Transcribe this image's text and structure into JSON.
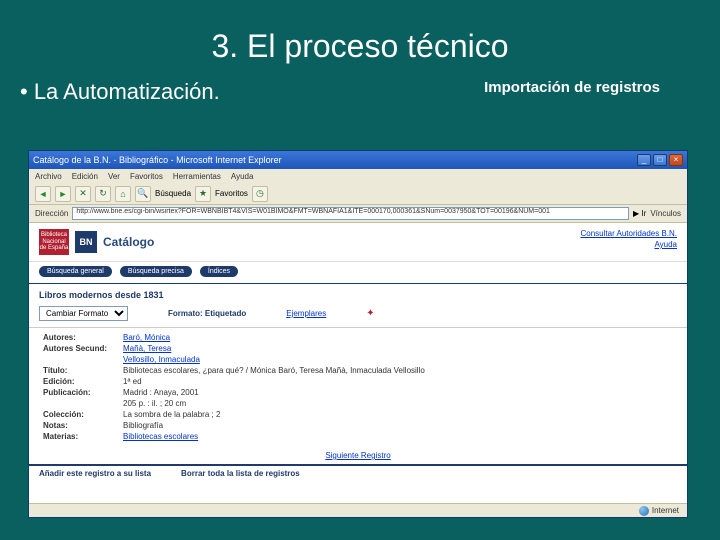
{
  "slide": {
    "title": "3. El proceso técnico",
    "bullet": "• La Automatización.",
    "subtitle": "Importación de registros"
  },
  "window": {
    "title": "Catálogo de la B.N. - Bibliográfico - Microsoft Internet Explorer",
    "menu": [
      "Archivo",
      "Edición",
      "Ver",
      "Favoritos",
      "Herramientas",
      "Ayuda"
    ],
    "toolbar": {
      "search": "Búsqueda",
      "favs": "Favoritos"
    },
    "addr": {
      "label": "Dirección",
      "url": "http://www.bne.es/cgi-bin/wsirtex?FOR=WBNBIBT4&VIS=W01BIMO&FMT=WBNAFIA1&ITE=000170,000361&SNum=0037950&TOT=00196&NUM=001",
      "go": "Ir",
      "links": "Vínculos"
    }
  },
  "page": {
    "logo": {
      "top": "Biblioteca",
      "mid": "Nacional",
      "bot": "de España",
      "bn": "BN",
      "catalogo": "Catálogo"
    },
    "links": {
      "authorities": "Consultar Autoridades B.N.",
      "help": "Ayuda"
    },
    "tabs": [
      "Búsqueda general",
      "Búsqueda precisa",
      "Índices"
    ],
    "section": "Libros modernos desde 1831",
    "select": "Cambiar Formato",
    "format_label": "Formato: Etiquetado",
    "ejemplares": "Ejemplares",
    "fields": {
      "autores_lbl": "Autores:",
      "autores_val": "Baró, Mónica",
      "secund_lbl": "Autores Secund:",
      "secund_val1": "Mañà, Teresa",
      "secund_val2": "Vellosillo, Inmaculada",
      "titulo_lbl": "Título:",
      "titulo_val": "Bibliotecas escolares, ¿para qué? / Mónica Baró, Teresa Mañà, Inmaculada Vellosillo",
      "edicion_lbl": "Edición:",
      "edicion_val": "1ª ed",
      "publicacion_lbl": "Publicación:",
      "publicacion_val": "Madrid : Anaya, 2001",
      "desc_val": "205 p. : il. ; 20 cm",
      "coleccion_lbl": "Colección:",
      "coleccion_val": "La sombra de la palabra ; 2",
      "notas_lbl": "Notas:",
      "notas_val": "Bibliografía",
      "materias_lbl": "Materias:",
      "materias_val": "Bibliotecas escolares"
    },
    "next": "Siguiente Registro",
    "footer": {
      "add": "Añadir este registro a su lista",
      "clear": "Borrar toda la lista de registros"
    }
  },
  "status": {
    "text": "",
    "zone": "Internet"
  }
}
